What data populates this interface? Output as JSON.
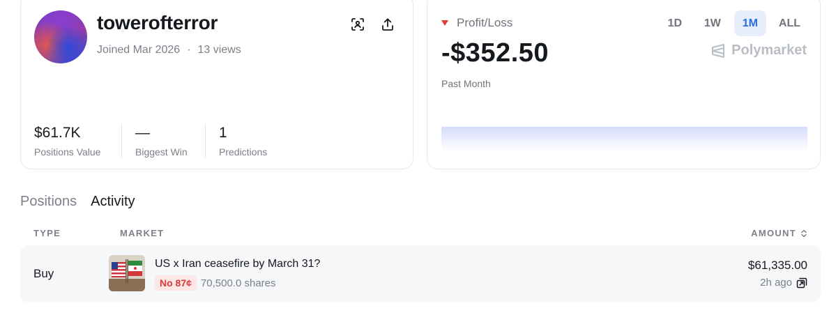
{
  "profile": {
    "username": "towerofterror",
    "joined": "Joined Mar 2026",
    "separator": "·",
    "views": "13 views",
    "actions": {
      "scan_icon": "scan-icon",
      "share_icon": "share-icon"
    },
    "stats": [
      {
        "value": "$61.7K",
        "label": "Positions Value"
      },
      {
        "value": "—",
        "label": "Biggest Win"
      },
      {
        "value": "1",
        "label": "Predictions"
      }
    ]
  },
  "pnl": {
    "title": "Profit/Loss",
    "direction_icon": "triangle-down-icon",
    "value": "-$352.50",
    "period": "Past Month",
    "brand": "Polymarket",
    "ranges": [
      "1D",
      "1W",
      "1M",
      "ALL"
    ],
    "active_range": "1M",
    "colors": {
      "negative": "#e03a3a",
      "accent": "#2b6ddb",
      "chart_fill": "#d5dbfb"
    }
  },
  "tabs": {
    "items": [
      "Positions",
      "Activity"
    ],
    "active": "Activity"
  },
  "table": {
    "headers": {
      "type": "TYPE",
      "market": "MARKET",
      "amount": "AMOUNT"
    },
    "sort_icon": "sort-icon",
    "rows": [
      {
        "type": "Buy",
        "market": "US x Iran ceasefire by March 31?",
        "outcome": "No 87¢",
        "shares": "70,500.0 shares",
        "amount": "$61,335.00",
        "time": "2h ago",
        "link_icon": "external-link-icon"
      }
    ]
  }
}
